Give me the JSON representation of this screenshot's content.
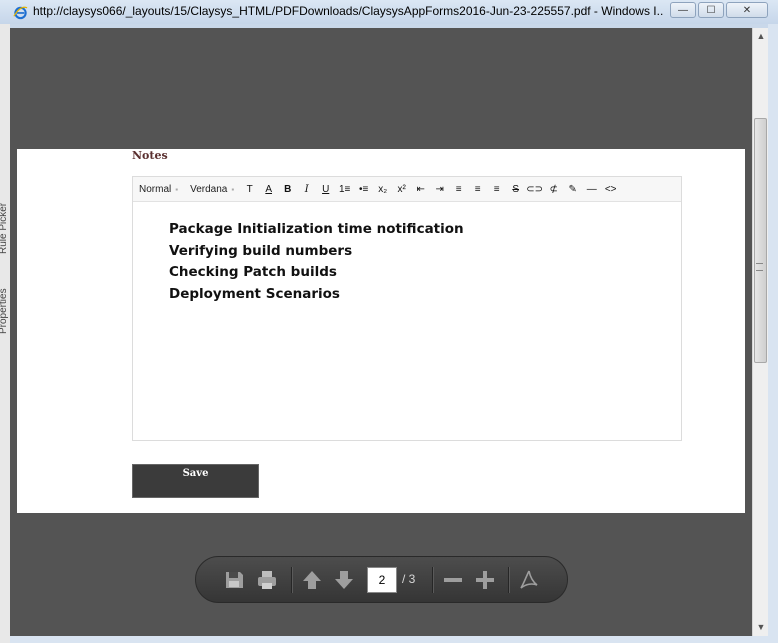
{
  "window": {
    "title": "http://claysys066/_layouts/15/Claysys_HTML/PDFDownloads/ClaysysAppForms2016-Jun-23-225557.pdf - Windows I...",
    "minimize": "—",
    "maximize": "☐",
    "close": "✕"
  },
  "background": {
    "labels": [
      "Rule Picker",
      "Properties"
    ]
  },
  "document": {
    "notes_label": "Notes",
    "toolbar": {
      "format": "Normal",
      "font": "Verdana",
      "buttons": [
        "T",
        "A",
        "B",
        "I",
        "U",
        "1≡",
        "•≡",
        "x₂",
        "x²",
        "⇤",
        "⇥",
        "≡",
        "≡",
        "≡",
        "S",
        "⊂⊃",
        "⊄",
        "✎",
        "—",
        "<>"
      ]
    },
    "content_lines": [
      "Package Initialization time notification",
      "Verifying build numbers",
      "Checking Patch builds",
      "Deployment Scenarios"
    ],
    "save_label": "Save"
  },
  "pdf_toolbar": {
    "current_page": "2",
    "total_pages": "/ 3"
  }
}
